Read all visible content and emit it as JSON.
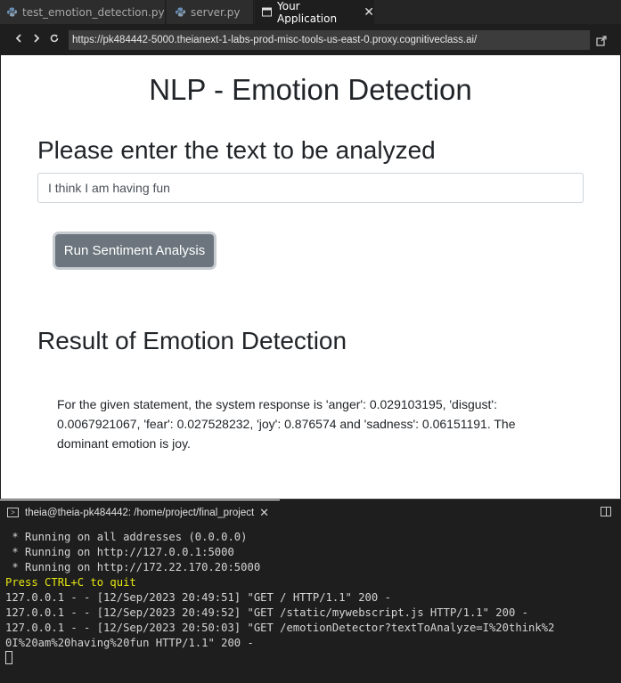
{
  "editor_tabs": [
    {
      "label": "test_emotion_detection.py",
      "icon": "python-file-icon"
    },
    {
      "label": "server.py",
      "icon": "python-file-icon"
    },
    {
      "label": "Your Application",
      "icon": "browser-window-icon",
      "active": true
    }
  ],
  "browser": {
    "url": "https://pk484442-5000.theianext-1-labs-prod-misc-tools-us-east-0.proxy.cognitiveclass.ai/",
    "back_icon": "‹",
    "forward_icon": "›",
    "reload_icon": "⟳"
  },
  "page": {
    "title": "NLP - Emotion Detection",
    "input_heading": "Please enter the text to be analyzed",
    "input_value": "I think I am having fun",
    "run_button": "Run Sentiment Analysis",
    "result_heading": "Result of Emotion Detection",
    "result_text": "For the given statement, the system response is 'anger': 0.029103195, 'disgust': 0.0067921067, 'fear': 0.027528232, 'joy': 0.876574 and 'sadness': 0.06151191. The dominant emotion is joy."
  },
  "terminal": {
    "tab_title": "theia@theia-pk484442: /home/project/final_project",
    "lines": [
      " * Running on all addresses (0.0.0.0)",
      " * Running on http://127.0.0.1:5000",
      " * Running on http://172.22.170.20:5000",
      "Press CTRL+C to quit",
      "127.0.0.1 - - [12/Sep/2023 20:49:51] \"GET / HTTP/1.1\" 200 -",
      "127.0.0.1 - - [12/Sep/2023 20:49:52] \"GET /static/mywebscript.js HTTP/1.1\" 200 -",
      "127.0.0.1 - - [12/Sep/2023 20:50:03] \"GET /emotionDetector?textToAnalyze=I%20think%2",
      "0I%20am%20having%20fun HTTP/1.1\" 200 -"
    ],
    "highlight_color": "#e5e510"
  }
}
